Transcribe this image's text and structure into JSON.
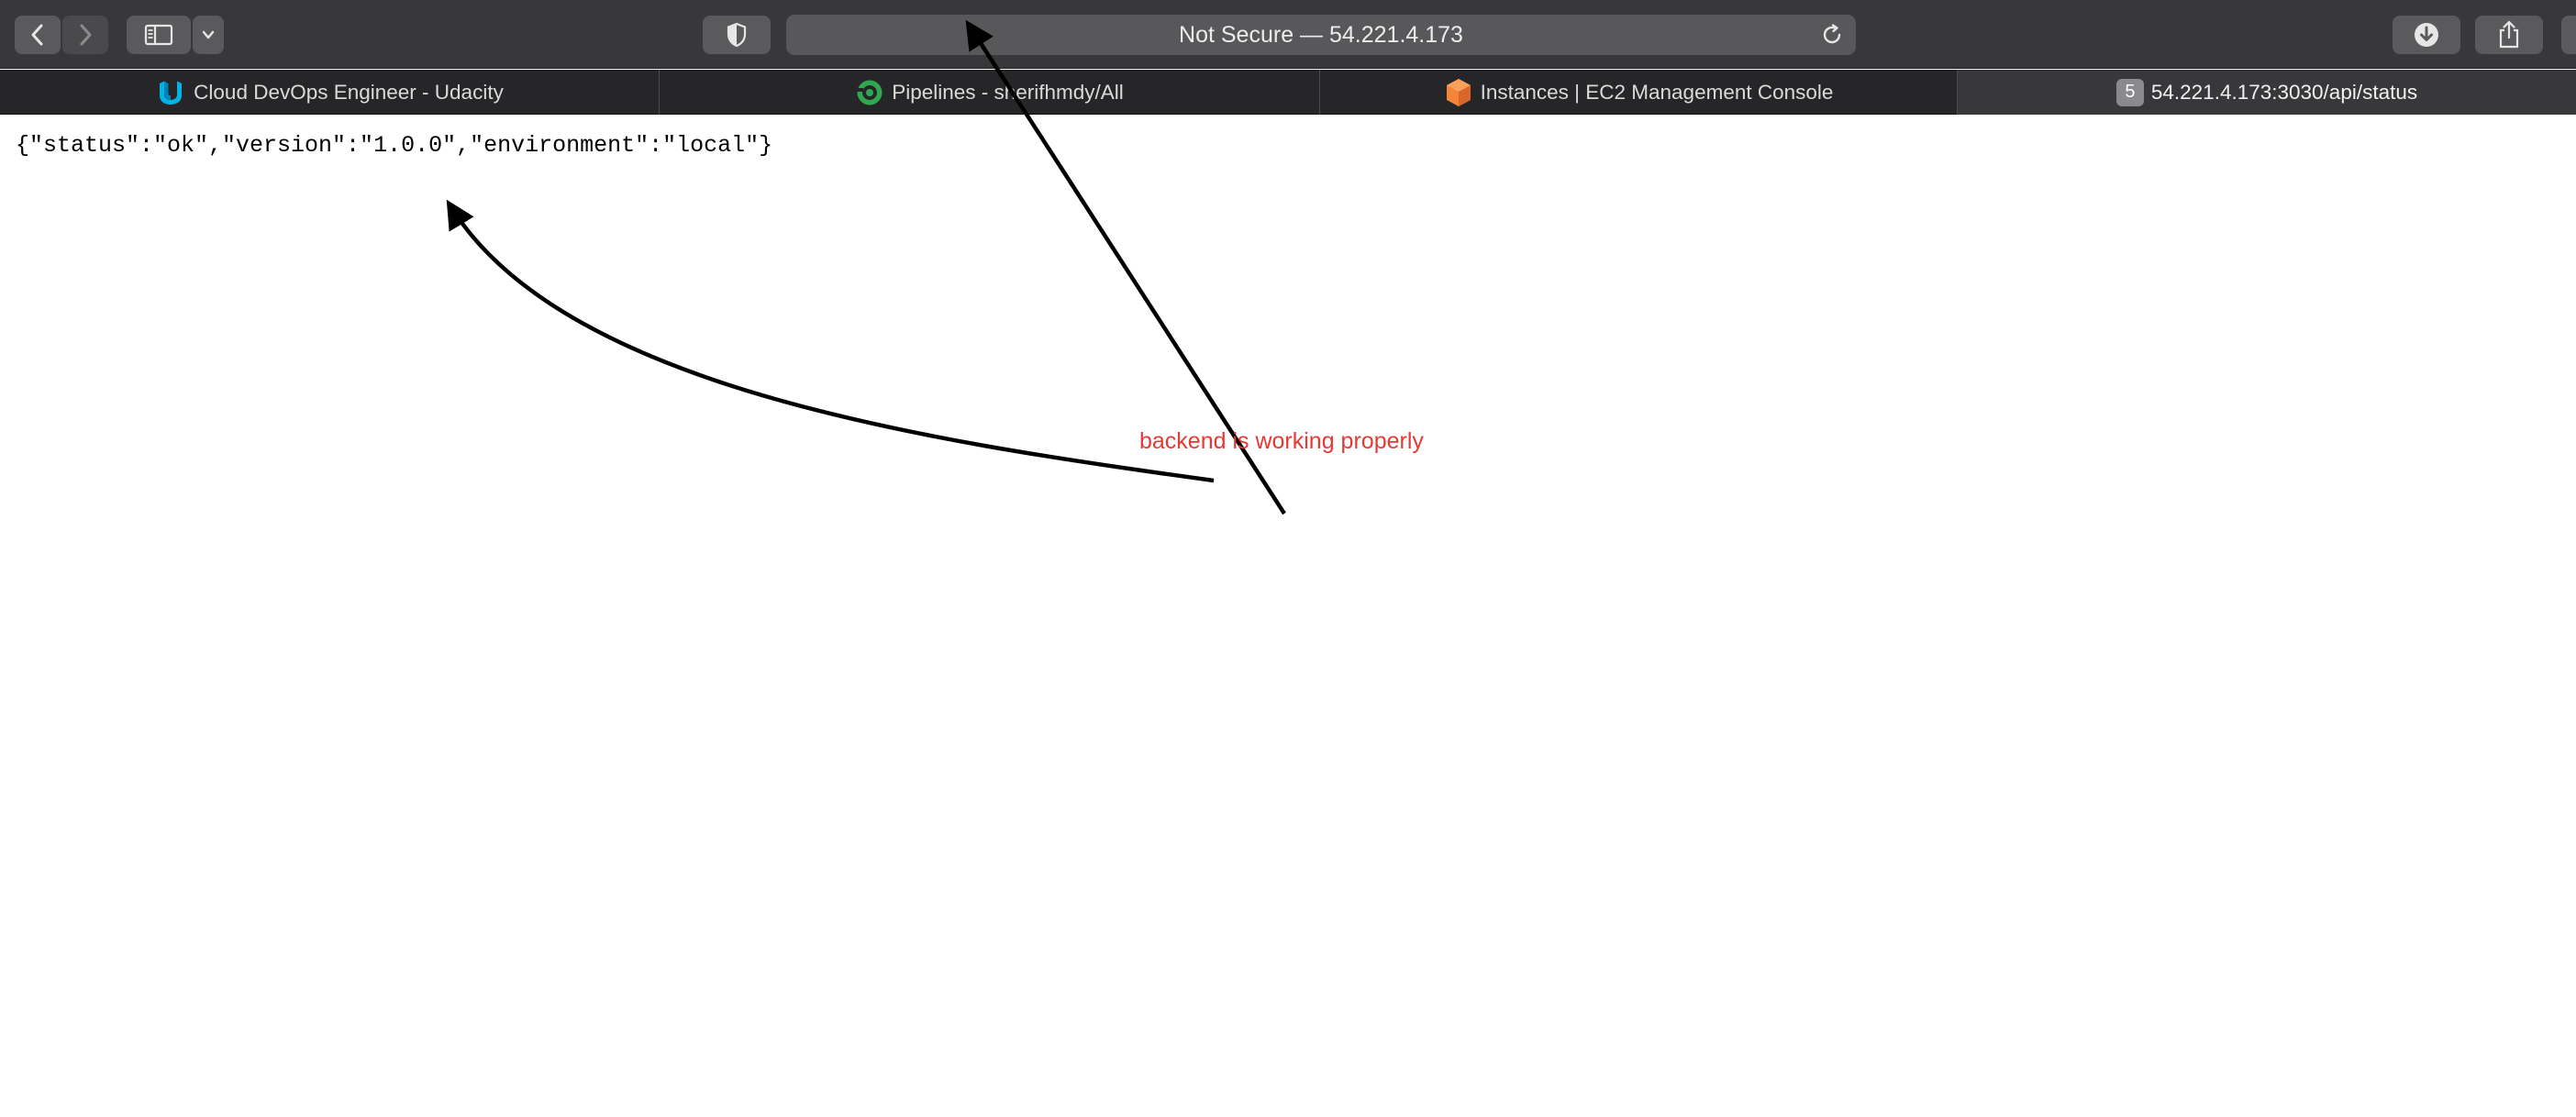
{
  "toolbar": {
    "address_text": "Not Secure — 54.221.4.173",
    "icons": {
      "back": "chevron-left-icon",
      "forward": "chevron-right-icon",
      "sidebar": "sidebar-icon",
      "sidebar_menu": "chevron-down-icon",
      "privacy": "shield-icon",
      "reload": "reload-icon",
      "downloads": "download-icon",
      "share": "share-icon"
    }
  },
  "tabs": [
    {
      "label": "Cloud DevOps Engineer - Udacity",
      "icon": "udacity-icon",
      "active": false
    },
    {
      "label": "Pipelines - sherifhmdy/All",
      "icon": "circleci-icon",
      "active": false
    },
    {
      "label": "Instances | EC2 Management Console",
      "icon": "aws-ec2-icon",
      "active": false
    },
    {
      "label": "54.221.4.173:3030/api/status",
      "icon": "tab-number-badge",
      "badge": "5",
      "active": true
    }
  ],
  "page": {
    "json_text": "{\"status\":\"ok\",\"version\":\"1.0.0\",\"environment\":\"local\"}"
  },
  "annotation": {
    "text": "backend is working properly",
    "color": "#e53935"
  },
  "colors": {
    "toolbar_bg": "#38383b",
    "tabbar_bg": "#262628",
    "active_tab_bg": "#38383b"
  }
}
